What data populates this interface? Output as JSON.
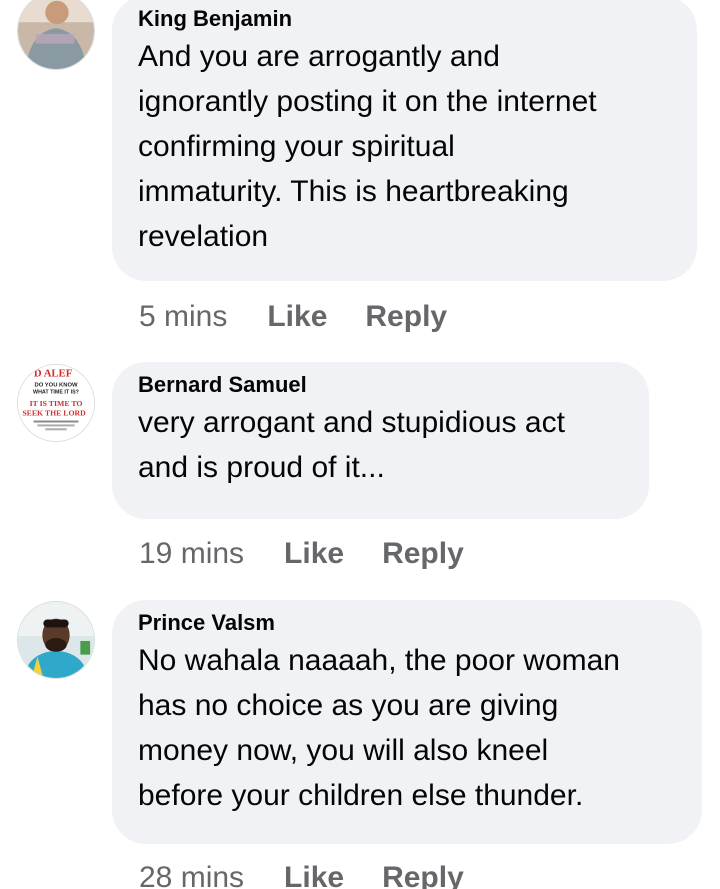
{
  "comments": [
    {
      "author": "King Benjamin",
      "text": "And you are arrogantly and\nignorantly posting  it on the internet\nconfirming your spiritual\nimmaturity. This is heartbreaking\nrevelation",
      "time": "5 mins",
      "like_label": "Like",
      "reply_label": "Reply"
    },
    {
      "author": "Bernard Samuel",
      "avatar_text": {
        "line1": "D ALEF",
        "line2": "DO YOU KNOW",
        "line3": "WHAT TIME IT IS?",
        "line4": "IT IS TIME TO",
        "line5": "SEEK THE LORD"
      },
      "text": "very arrogant and stupidious act\nand is proud of it...",
      "time": "19 mins",
      "like_label": "Like",
      "reply_label": "Reply"
    },
    {
      "author": "Prince Valsm",
      "text": "No wahala naaaah, the poor woman\nhas no choice as you are giving\nmoney now, you will also kneel\nbefore your children else thunder.",
      "time": "28 mins",
      "like_label": "Like",
      "reply_label": "Reply"
    }
  ],
  "colors": {
    "bubble": "#f0f2f5",
    "meta": "#65676b",
    "text": "#050505",
    "avatar_accent_red": "#d22c2c"
  }
}
